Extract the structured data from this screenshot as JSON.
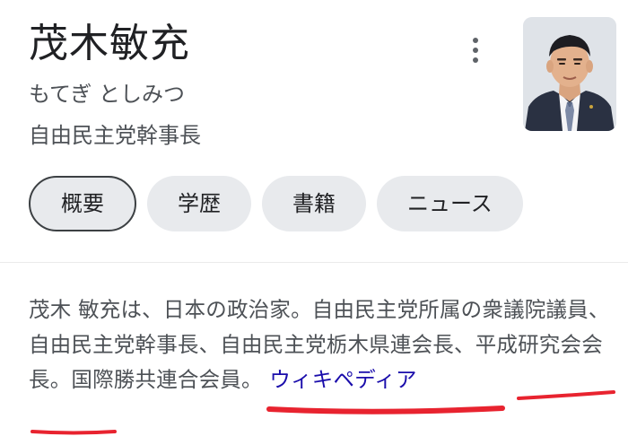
{
  "knowledge_panel": {
    "name": "茂木敏充",
    "reading": "もてぎ としみつ",
    "title": "自由民主党幹事長",
    "more_icon": "more-vert-icon",
    "photo_icon": "person-photo"
  },
  "tabs": [
    {
      "label": "概要",
      "active": true
    },
    {
      "label": "学歴",
      "active": false
    },
    {
      "label": "書籍",
      "active": false
    },
    {
      "label": "ニュース",
      "active": false
    }
  ],
  "description": {
    "text_before_highlight": "茂木 敏充は、日本の政治家。自由民主党所属の衆議院議員、自由民主党幹事長、自由民主党栃木県連会長、平成研究会会長。",
    "highlight": "国際勝共連合会員。",
    "link_label": "ウィキペディア"
  },
  "colors": {
    "link": "#1a0dab",
    "underline_annotation": "#e8232f",
    "chip_background": "#e8eaed"
  }
}
